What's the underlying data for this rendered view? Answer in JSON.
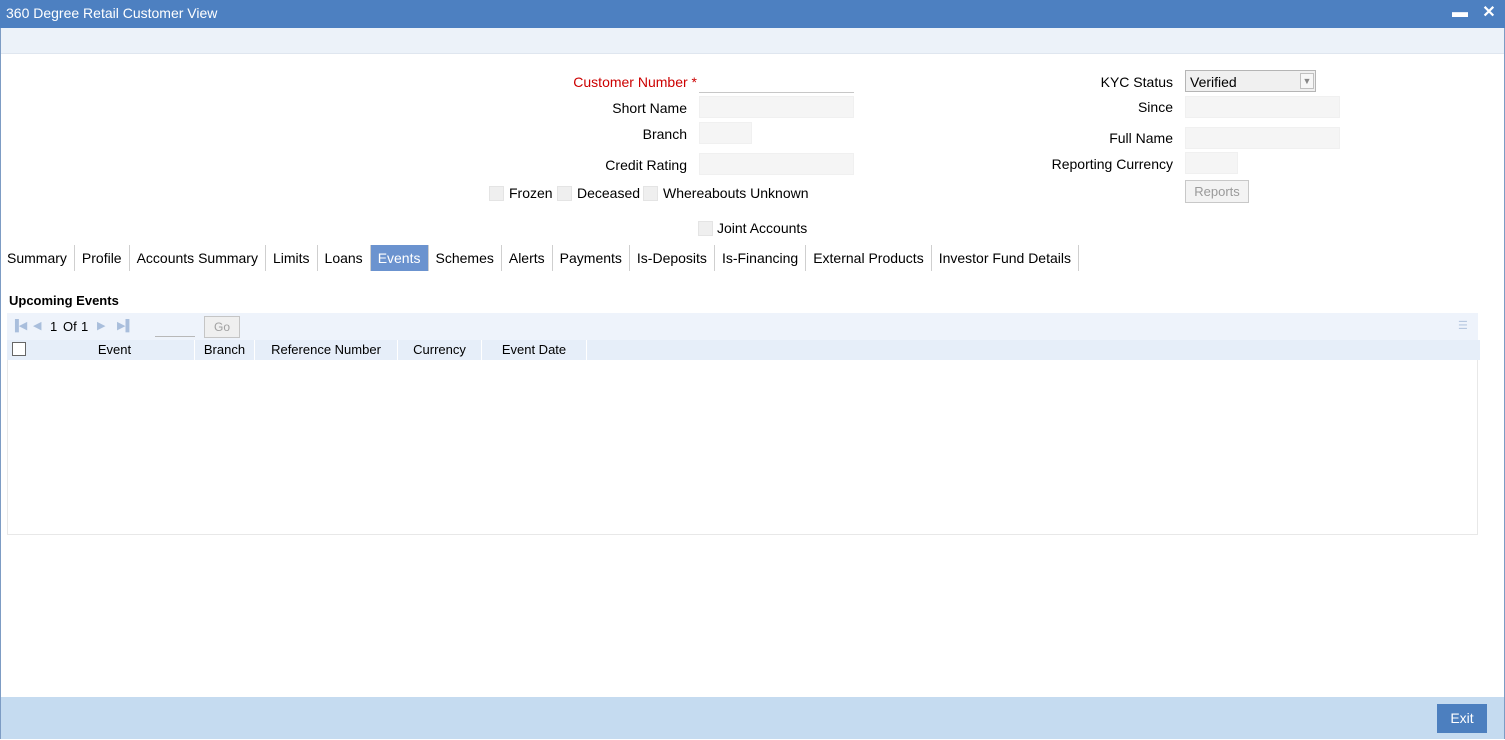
{
  "window": {
    "title": "360 Degree Retail Customer View",
    "minimize_glyph": "▬",
    "close_glyph": "✕"
  },
  "form": {
    "customer_number_label": "Customer Number",
    "required_marker": "*",
    "short_name_label": "Short Name",
    "branch_label": "Branch",
    "credit_rating_label": "Credit Rating",
    "kyc_status_label": "KYC Status",
    "kyc_status_value": "Verified",
    "since_label": "Since",
    "full_name_label": "Full Name",
    "reporting_currency_label": "Reporting Currency",
    "reports_button": "Reports",
    "frozen_label": "Frozen",
    "deceased_label": "Deceased",
    "whereabouts_label": "Whereabouts Unknown",
    "joint_accounts_label": "Joint Accounts"
  },
  "tabs": [
    {
      "label": "Summary"
    },
    {
      "label": "Profile"
    },
    {
      "label": "Accounts Summary"
    },
    {
      "label": "Limits"
    },
    {
      "label": "Loans"
    },
    {
      "label": "Events",
      "active": true
    },
    {
      "label": "Schemes"
    },
    {
      "label": "Alerts"
    },
    {
      "label": "Payments"
    },
    {
      "label": "Is-Deposits"
    },
    {
      "label": "Is-Financing"
    },
    {
      "label": "External Products"
    },
    {
      "label": "Investor Fund Details"
    }
  ],
  "events": {
    "section_title": "Upcoming Events",
    "pager": {
      "current": "1",
      "of_label": "Of",
      "total": "1",
      "go_label": "Go"
    },
    "columns": [
      "Event",
      "Branch",
      "Reference Number",
      "Currency",
      "Event Date"
    ],
    "rows": []
  },
  "footer": {
    "exit_label": "Exit"
  },
  "colors": {
    "titlebar": "#4d80c1",
    "active_tab": "#6b93cf",
    "footer": "#c5dbf0",
    "exit_button": "#4c7fbf",
    "required": "#cc0000"
  }
}
